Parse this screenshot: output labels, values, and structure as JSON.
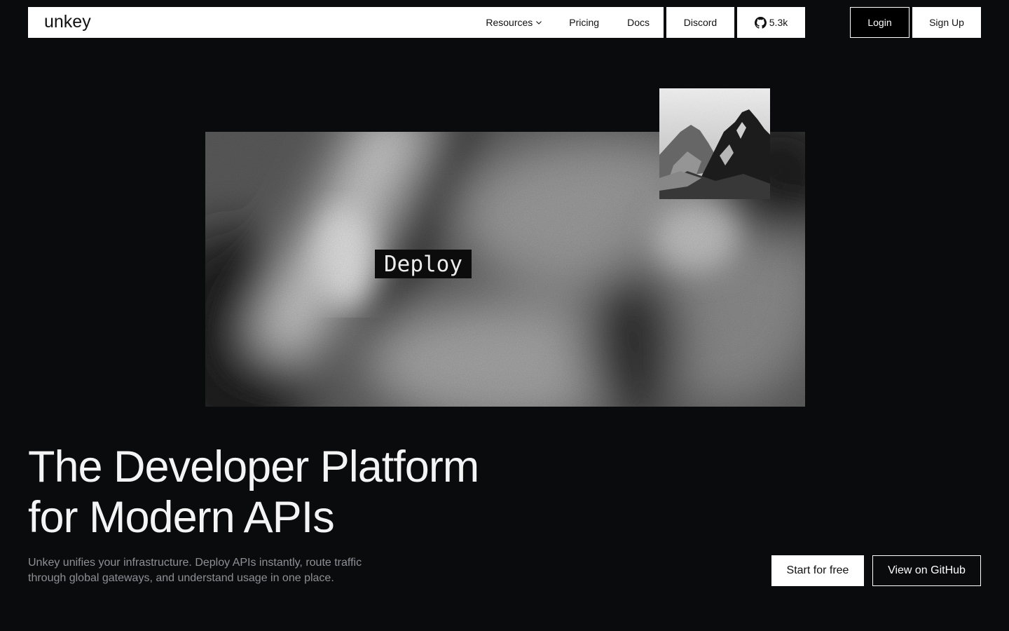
{
  "brand": {
    "logo_text": "unkey"
  },
  "nav": {
    "resources_label": "Resources",
    "pricing_label": "Pricing",
    "docs_label": "Docs",
    "discord_label": "Discord",
    "github_stars": "5.3k",
    "login_label": "Login",
    "signup_label": "Sign Up"
  },
  "hero": {
    "tag": "Deploy",
    "headline_line1": "The Developer Platform",
    "headline_line2": "for Modern APIs",
    "subtext": "Unkey unifies your infrastructure. Deploy APIs instantly, route traffic through global gateways, and understand usage in one place.",
    "cta_primary": "Start for free",
    "cta_secondary": "View on GitHub"
  },
  "colors": {
    "background": "#0a0b0d",
    "nav_surface": "#ffffff",
    "text_primary": "#f4f4f4",
    "text_muted": "#8e9096"
  }
}
